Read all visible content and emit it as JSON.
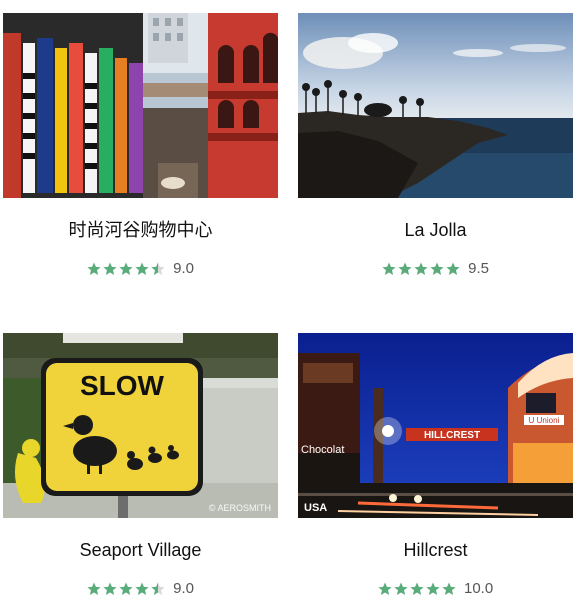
{
  "colors": {
    "star": "#5aab7a",
    "star_empty": "#d8d8d8"
  },
  "cards": [
    {
      "title": "时尚河谷购物中心",
      "rating_text": "9.0",
      "rating": 4.5,
      "photo_icon": "shopping-mall-photo",
      "watermark": ""
    },
    {
      "title": "La Jolla",
      "rating_text": "9.5",
      "rating": 5,
      "photo_icon": "coastline-photo",
      "watermark": ""
    },
    {
      "title": "Seaport Village",
      "rating_text": "9.0",
      "rating": 4.5,
      "photo_icon": "slow-duck-sign-photo",
      "watermark": "© AEROSMITH",
      "sign_text": "SLOW"
    },
    {
      "title": "Hillcrest",
      "rating_text": "10.0",
      "rating": 5,
      "photo_icon": "hillcrest-night-photo",
      "watermark": "USA",
      "sign_text": "HILLCREST",
      "sign_text_2": "Chocolat",
      "sign_text_3": "U Unioni"
    }
  ]
}
